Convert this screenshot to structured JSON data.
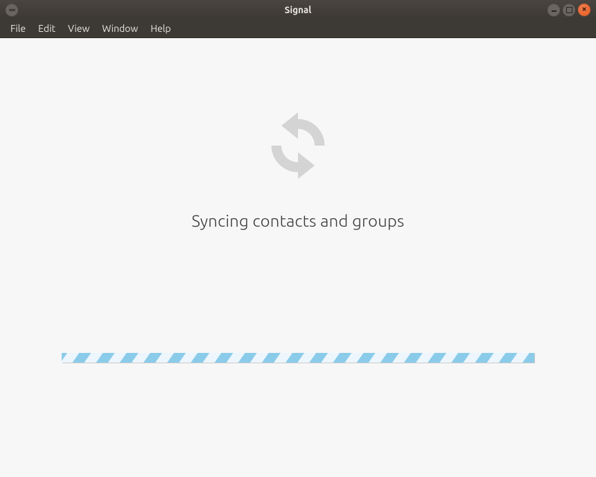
{
  "window": {
    "title": "Signal"
  },
  "menubar": {
    "items": [
      "File",
      "Edit",
      "View",
      "Window",
      "Help"
    ]
  },
  "main": {
    "status_text": "Syncing contacts and groups"
  }
}
